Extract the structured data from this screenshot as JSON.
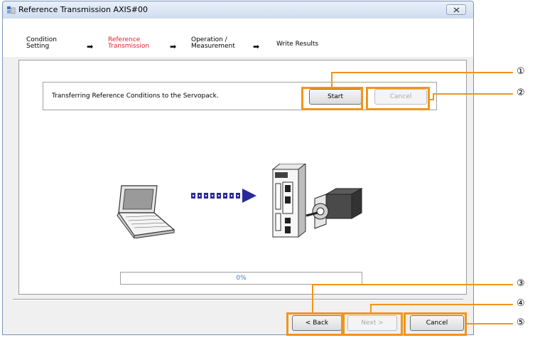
{
  "window": {
    "title": "Reference Transmission AXIS#00"
  },
  "steps": [
    {
      "label": "Condition\nSetting"
    },
    {
      "label": "Reference\nTransmission",
      "active": true
    },
    {
      "label": "Operation /\nMeasurement"
    },
    {
      "label": "Write Results"
    }
  ],
  "step_arrow": "➡",
  "transfer": {
    "message": "Transferring Reference Conditions to the Servopack.",
    "start_label": "Start",
    "cancel_label": "Cancel"
  },
  "progress": {
    "value": 0,
    "text": "0%"
  },
  "footer": {
    "back_label": "< Back",
    "next_label": "Next >",
    "cancel_label": "Cancel"
  },
  "callouts": [
    "①",
    "②",
    "③",
    "④",
    "⑤"
  ],
  "colors": {
    "highlight": "#f39418",
    "active_step": "#e4202a",
    "transfer_arrow": "#2a2a9a"
  }
}
